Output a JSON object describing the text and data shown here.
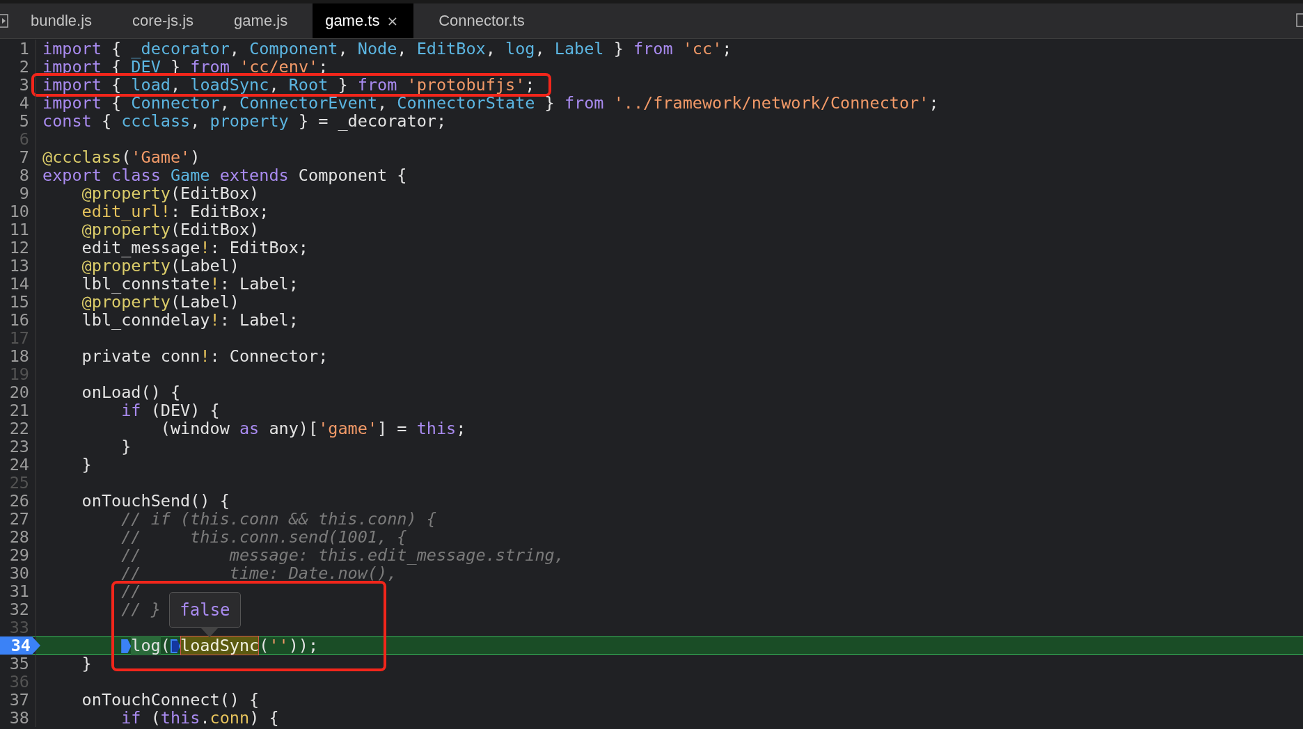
{
  "tabs": [
    {
      "label": "bundle.js",
      "selected": false,
      "closable": false
    },
    {
      "label": "core-js.js",
      "selected": false,
      "closable": false
    },
    {
      "label": "game.js",
      "selected": false,
      "closable": false
    },
    {
      "label": "game.ts",
      "selected": true,
      "closable": true,
      "close": "×"
    },
    {
      "label": "Connector.ts",
      "selected": false,
      "closable": false
    }
  ],
  "lines": [
    {
      "number": "1",
      "current": false,
      "boxed": false,
      "tokens": [
        {
          "kind": "kw",
          "text": "import"
        },
        {
          "kind": "text",
          "text": " { "
        },
        {
          "kind": "name",
          "text": "_decorator"
        },
        {
          "kind": "text",
          "text": ", "
        },
        {
          "kind": "name",
          "text": "Component"
        },
        {
          "kind": "text",
          "text": ", "
        },
        {
          "kind": "name",
          "text": "Node"
        },
        {
          "kind": "text",
          "text": ", "
        },
        {
          "kind": "name",
          "text": "EditBox"
        },
        {
          "kind": "text",
          "text": ", "
        },
        {
          "kind": "name",
          "text": "log"
        },
        {
          "kind": "text",
          "text": ", "
        },
        {
          "kind": "name",
          "text": "Label"
        },
        {
          "kind": "text",
          "text": " } "
        },
        {
          "kind": "kw",
          "text": "from"
        },
        {
          "kind": "str",
          "text": " 'cc'"
        },
        {
          "kind": "text",
          "text": ";"
        }
      ]
    },
    {
      "number": "2",
      "current": false,
      "boxed": false,
      "tokens": [
        {
          "kind": "kw",
          "text": "import"
        },
        {
          "kind": "text",
          "text": " { "
        },
        {
          "kind": "name",
          "text": "DEV"
        },
        {
          "kind": "text",
          "text": " } "
        },
        {
          "kind": "kw",
          "text": "from"
        },
        {
          "kind": "str",
          "text": " 'cc/env'"
        },
        {
          "kind": "text",
          "text": ";"
        }
      ]
    },
    {
      "number": "3",
      "current": false,
      "boxed": true,
      "tokens": [
        {
          "kind": "kw",
          "text": "import"
        },
        {
          "kind": "text",
          "text": " { "
        },
        {
          "kind": "name",
          "text": "load"
        },
        {
          "kind": "text",
          "text": ", "
        },
        {
          "kind": "name",
          "text": "loadSync"
        },
        {
          "kind": "text",
          "text": ", "
        },
        {
          "kind": "name",
          "text": "Root"
        },
        {
          "kind": "text",
          "text": " } "
        },
        {
          "kind": "kw",
          "text": "from"
        },
        {
          "kind": "str",
          "text": " 'protobufjs'"
        },
        {
          "kind": "text",
          "text": ";"
        }
      ]
    },
    {
      "number": "4",
      "current": false,
      "boxed": false,
      "tokens": [
        {
          "kind": "kw",
          "text": "import"
        },
        {
          "kind": "text",
          "text": " { "
        },
        {
          "kind": "name",
          "text": "Connector"
        },
        {
          "kind": "text",
          "text": ", "
        },
        {
          "kind": "name",
          "text": "ConnectorEvent"
        },
        {
          "kind": "text",
          "text": ", "
        },
        {
          "kind": "name",
          "text": "ConnectorState"
        },
        {
          "kind": "text",
          "text": " } "
        },
        {
          "kind": "kw",
          "text": "from"
        },
        {
          "kind": "str",
          "text": " '../framework/network/Connector'"
        },
        {
          "kind": "text",
          "text": ";"
        }
      ]
    },
    {
      "number": "5",
      "current": false,
      "boxed": false,
      "tokens": [
        {
          "kind": "kw",
          "text": "const"
        },
        {
          "kind": "text",
          "text": " { "
        },
        {
          "kind": "name",
          "text": "ccclass"
        },
        {
          "kind": "text",
          "text": ", "
        },
        {
          "kind": "name",
          "text": "property"
        },
        {
          "kind": "text",
          "text": " } = _decorator;"
        }
      ]
    },
    {
      "number": "6",
      "current": false,
      "boxed": false
    },
    {
      "number": "7",
      "current": false,
      "boxed": false,
      "tokens": [
        {
          "kind": "deco",
          "text": "@ccclass"
        },
        {
          "kind": "text",
          "text": "("
        },
        {
          "kind": "str",
          "text": "'Game'"
        },
        {
          "kind": "text",
          "text": ")"
        }
      ]
    },
    {
      "number": "8",
      "current": false,
      "boxed": false,
      "tokens": [
        {
          "kind": "kw",
          "text": "export class"
        },
        {
          "kind": "name",
          "text": " Game"
        },
        {
          "kind": "kw",
          "text": " extends"
        },
        {
          "kind": "text",
          "text": " Component {"
        }
      ]
    },
    {
      "number": "9",
      "current": false,
      "boxed": false,
      "tokens": [
        {
          "kind": "deco",
          "text": "    @property"
        },
        {
          "kind": "text",
          "text": "(EditBox)"
        }
      ]
    },
    {
      "number": "10",
      "current": false,
      "boxed": false,
      "tokens": [
        {
          "kind": "field",
          "text": "    edit_url!"
        },
        {
          "kind": "text",
          "text": ": EditBox;"
        }
      ]
    },
    {
      "number": "11",
      "current": false,
      "boxed": false,
      "tokens": [
        {
          "kind": "deco",
          "text": "    @property"
        },
        {
          "kind": "text",
          "text": "(EditBox)"
        }
      ]
    },
    {
      "number": "12",
      "current": false,
      "boxed": false,
      "tokens": [
        {
          "kind": "text",
          "text": "    edit_message"
        },
        {
          "kind": "field",
          "text": "!"
        },
        {
          "kind": "text",
          "text": ": EditBox;"
        }
      ]
    },
    {
      "number": "13",
      "current": false,
      "boxed": false,
      "tokens": [
        {
          "kind": "deco",
          "text": "    @property"
        },
        {
          "kind": "text",
          "text": "(Label)"
        }
      ]
    },
    {
      "number": "14",
      "current": false,
      "boxed": false,
      "tokens": [
        {
          "kind": "text",
          "text": "    lbl_connstate"
        },
        {
          "kind": "field",
          "text": "!"
        },
        {
          "kind": "text",
          "text": ": Label;"
        }
      ]
    },
    {
      "number": "15",
      "current": false,
      "boxed": false,
      "tokens": [
        {
          "kind": "deco",
          "text": "    @property"
        },
        {
          "kind": "text",
          "text": "(Label)"
        }
      ]
    },
    {
      "number": "16",
      "current": false,
      "boxed": false,
      "tokens": [
        {
          "kind": "text",
          "text": "    lbl_conndelay"
        },
        {
          "kind": "field",
          "text": "!"
        },
        {
          "kind": "text",
          "text": ": Label;"
        }
      ]
    },
    {
      "number": "17",
      "current": false,
      "boxed": false
    },
    {
      "number": "18",
      "current": false,
      "boxed": false,
      "tokens": [
        {
          "kind": "text",
          "text": "    private conn"
        },
        {
          "kind": "field",
          "text": "!"
        },
        {
          "kind": "text",
          "text": ": Connector;"
        }
      ]
    },
    {
      "number": "19",
      "current": false,
      "boxed": false
    },
    {
      "number": "20",
      "current": false,
      "boxed": false,
      "tokens": [
        {
          "kind": "text",
          "text": "    onLoad() {"
        }
      ]
    },
    {
      "number": "21",
      "current": false,
      "boxed": false,
      "tokens": [
        {
          "kind": "kw",
          "text": "        if"
        },
        {
          "kind": "text",
          "text": " (DEV) {"
        }
      ]
    },
    {
      "number": "22",
      "current": false,
      "boxed": false,
      "tokens": [
        {
          "kind": "text",
          "text": "            (window "
        },
        {
          "kind": "kw",
          "text": "as"
        },
        {
          "kind": "text",
          "text": " any)["
        },
        {
          "kind": "str",
          "text": "'game'"
        },
        {
          "kind": "text",
          "text": "] = "
        },
        {
          "kind": "kw",
          "text": "this"
        },
        {
          "kind": "text",
          "text": ";"
        }
      ]
    },
    {
      "number": "23",
      "current": false,
      "boxed": false,
      "tokens": [
        {
          "kind": "text",
          "text": "        }"
        }
      ]
    },
    {
      "number": "24",
      "current": false,
      "boxed": false,
      "tokens": [
        {
          "kind": "text",
          "text": "    }"
        }
      ]
    },
    {
      "number": "25",
      "current": false,
      "boxed": false
    },
    {
      "number": "26",
      "current": false,
      "boxed": false,
      "tokens": [
        {
          "kind": "text",
          "text": "    onTouchSend() {"
        }
      ]
    },
    {
      "number": "27",
      "current": false,
      "boxed": false,
      "tokens": [
        {
          "kind": "comment",
          "text": "        // if (this.conn && this.conn) {"
        }
      ]
    },
    {
      "number": "28",
      "current": false,
      "boxed": false,
      "tokens": [
        {
          "kind": "comment",
          "text": "        //     this.conn.send(1001, {"
        }
      ]
    },
    {
      "number": "29",
      "current": false,
      "boxed": false,
      "tokens": [
        {
          "kind": "comment",
          "text": "        //         message: this.edit_message.string,"
        }
      ]
    },
    {
      "number": "30",
      "current": false,
      "boxed": false,
      "tokens": [
        {
          "kind": "comment",
          "text": "        //         time: Date.now(),"
        }
      ]
    },
    {
      "number": "31",
      "current": false,
      "boxed": false,
      "tokens": [
        {
          "kind": "comment",
          "text": "        //"
        }
      ]
    },
    {
      "number": "32",
      "current": false,
      "boxed": false,
      "tokens": [
        {
          "kind": "comment",
          "text": "        // }"
        }
      ]
    },
    {
      "number": "33",
      "current": false,
      "boxed": false
    },
    {
      "number": "34",
      "current": true,
      "boxed": true,
      "tokens": [
        {
          "kind": "step"
        },
        {
          "kind": "expr",
          "text": "log"
        },
        {
          "kind": "text",
          "text": "("
        },
        {
          "kind": "step-alt"
        },
        {
          "kind": "eval",
          "text": "loadSync",
          "tooltip": "false"
        },
        {
          "kind": "text",
          "text": "("
        },
        {
          "kind": "str",
          "text": "''"
        },
        {
          "kind": "text",
          "text": "));"
        }
      ]
    },
    {
      "number": "35",
      "current": false,
      "boxed": false,
      "tokens": [
        {
          "kind": "text",
          "text": "    }"
        }
      ]
    },
    {
      "number": "36",
      "current": false,
      "boxed": false
    },
    {
      "number": "37",
      "current": false,
      "boxed": false,
      "tokens": [
        {
          "kind": "text",
          "text": "    onTouchConnect() {"
        }
      ]
    },
    {
      "number": "38",
      "current": false,
      "boxed": false,
      "tokens": [
        {
          "kind": "kw",
          "text": "        if"
        },
        {
          "kind": "text",
          "text": " ("
        },
        {
          "kind": "kw",
          "text": "this"
        },
        {
          "kind": "text",
          "text": "."
        },
        {
          "kind": "field",
          "text": "conn"
        },
        {
          "kind": "text",
          "text": ") {"
        }
      ]
    }
  ]
}
